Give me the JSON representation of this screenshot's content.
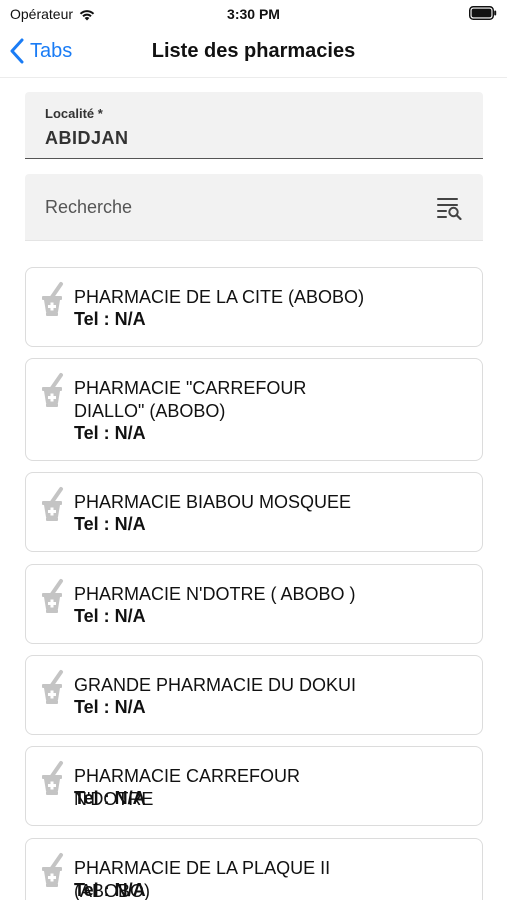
{
  "status_bar": {
    "carrier": "Opérateur",
    "time": "3:30 PM"
  },
  "nav": {
    "back_label": "Tabs",
    "title": "Liste des pharmacies"
  },
  "locality": {
    "label": "Localité *",
    "value": "ABIDJAN"
  },
  "search": {
    "placeholder": "Recherche"
  },
  "colors": {
    "accent": "#1a7cf5",
    "field_background": "#f2f2f2",
    "card_border": "#dcdcdc"
  },
  "pharmacies": [
    {
      "name": "PHARMACIE DE LA CITE (ABOBO)",
      "tel": "Tel : N/A"
    },
    {
      "name": "PHARMACIE \"CARREFOUR DIALLO\" (ABOBO)",
      "tel": "Tel : N/A"
    },
    {
      "name": "PHARMACIE BIABOU MOSQUEE",
      "tel": "Tel : N/A"
    },
    {
      "name": "PHARMACIE N'DOTRE ( ABOBO )",
      "tel": "Tel : N/A"
    },
    {
      "name": "GRANDE PHARMACIE DU DOKUI",
      "tel": "Tel : N/A"
    },
    {
      "name": "PHARMACIE CARREFOUR N'DOTRE",
      "tel": "Tel : N/A"
    },
    {
      "name": "PHARMACIE DE LA PLAQUE II (ABOBO)",
      "tel": "Tel : N/A"
    }
  ]
}
